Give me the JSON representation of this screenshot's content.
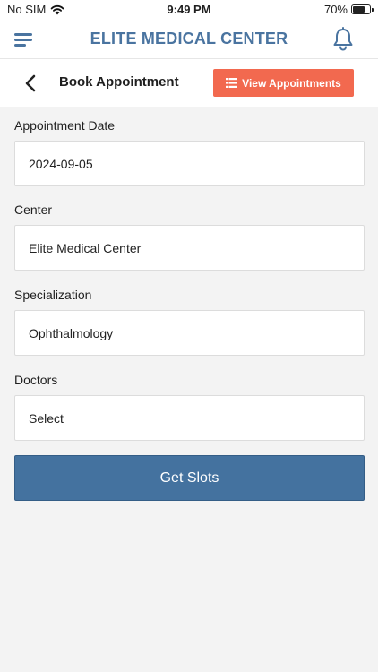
{
  "status_bar": {
    "carrier": "No SIM",
    "time": "9:49 PM",
    "battery_percent_label": "70%",
    "battery_level": 0.7
  },
  "header": {
    "title": "ELITE MEDICAL CENTER",
    "accent_color": "#4a74a0"
  },
  "sub_header": {
    "title": "Book Appointment",
    "view_button_label": "View Appointments",
    "view_button_color": "#f2694f"
  },
  "form": {
    "date_label": "Appointment Date",
    "date_value": "2024-09-05",
    "center_label": "Center",
    "center_value": "Elite Medical Center",
    "specialization_label": "Specialization",
    "specialization_value": "Ophthalmology",
    "doctors_label": "Doctors",
    "doctors_value": "Select",
    "submit_label": "Get Slots",
    "submit_color": "#44729f"
  }
}
